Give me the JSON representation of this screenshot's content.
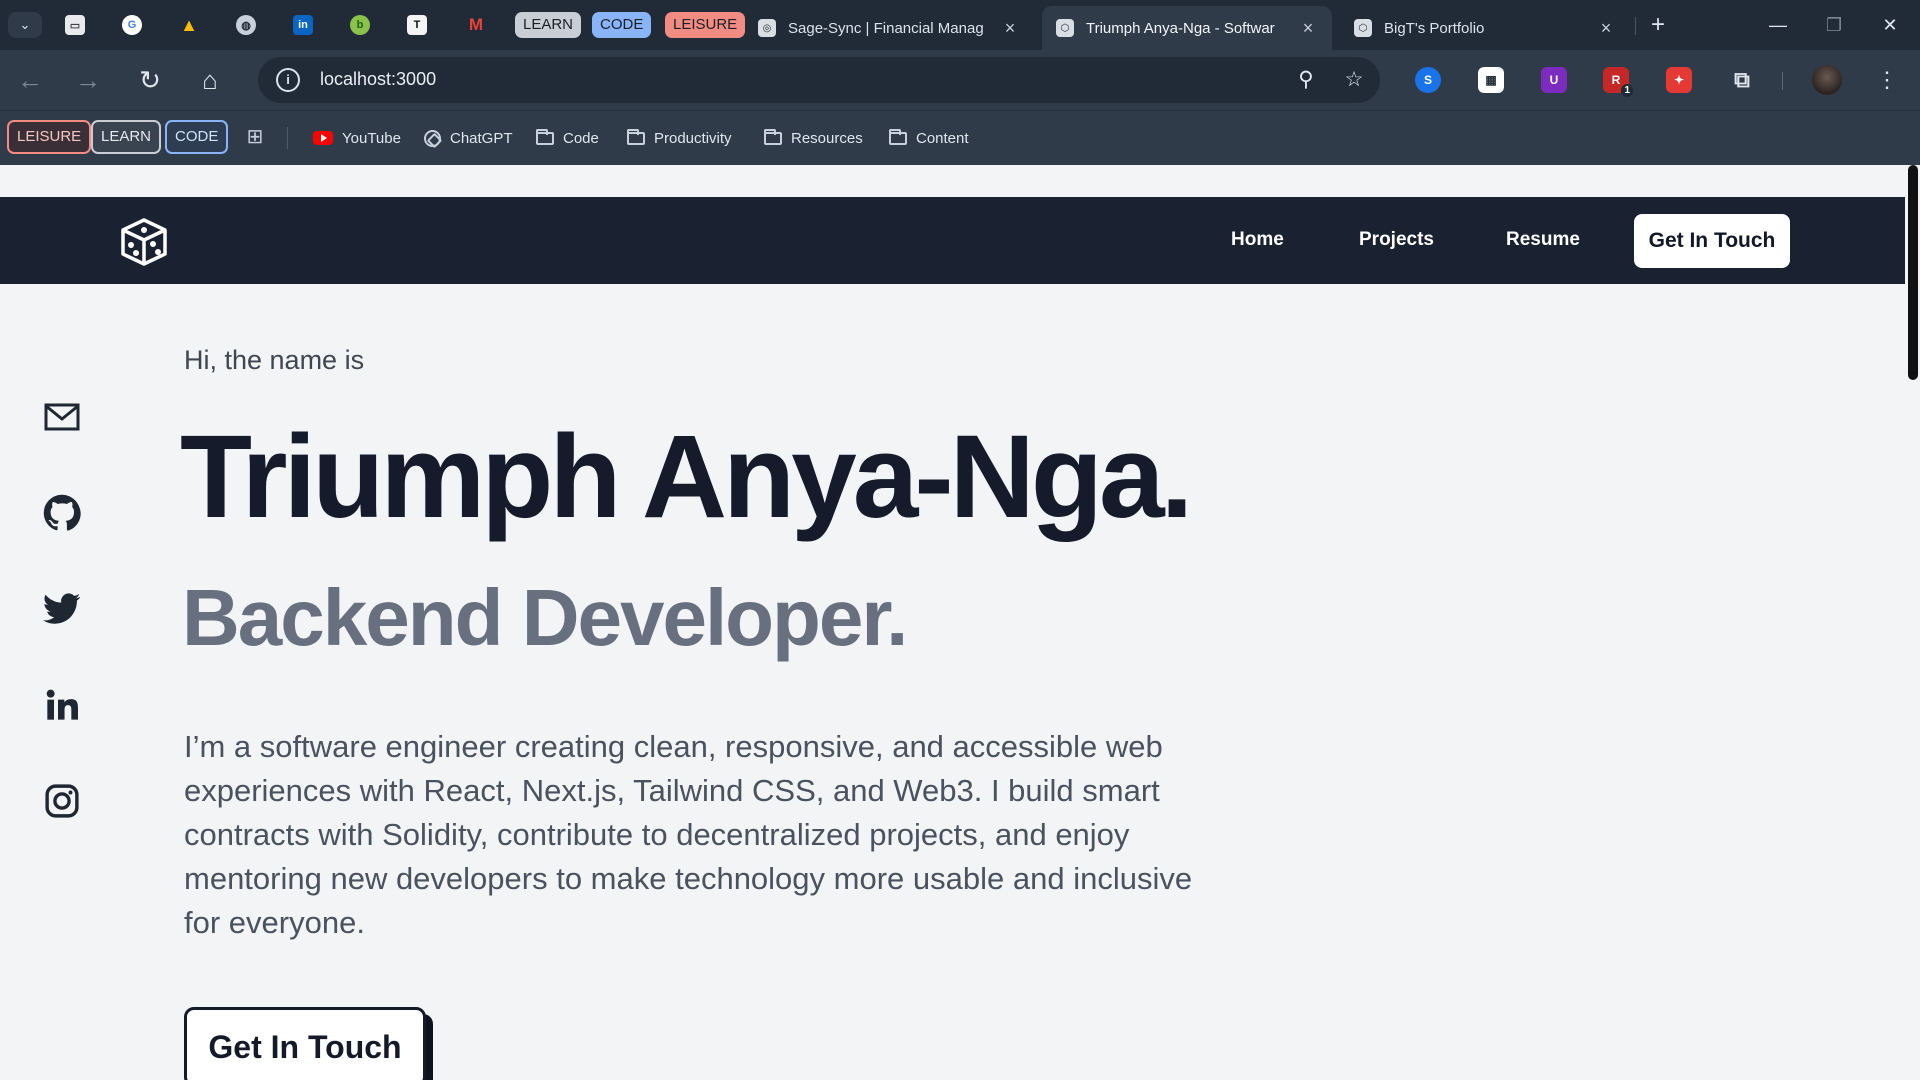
{
  "browser": {
    "tab_groups": [
      {
        "label": "LEARN",
        "color": "#c9ced6"
      },
      {
        "label": "CODE",
        "color": "#8ab4f8"
      },
      {
        "label": "LEISURE",
        "color": "#f28b82"
      }
    ],
    "tabs": [
      {
        "title": "Sage-Sync | Financial Manag",
        "active": false
      },
      {
        "title": "Triumph Anya-Nga - Softwar",
        "active": true
      },
      {
        "title": "BigT's Portfolio",
        "active": false
      }
    ],
    "address": "localhost:3000",
    "bookmarks": {
      "groups": [
        {
          "label": "LEISURE",
          "color": "#f28b82"
        },
        {
          "label": "LEARN",
          "color": "#c9ced6"
        },
        {
          "label": "CODE",
          "color": "#8ab4f8"
        }
      ],
      "items": [
        {
          "label": "YouTube",
          "icon": "youtube-icon"
        },
        {
          "label": "ChatGPT",
          "icon": "chatgpt-icon"
        },
        {
          "label": "Code",
          "icon": "folder-icon"
        },
        {
          "label": "Productivity",
          "icon": "folder-icon"
        },
        {
          "label": "Resources",
          "icon": "folder-icon"
        },
        {
          "label": "Content",
          "icon": "folder-icon"
        }
      ]
    },
    "extension_badge": "1"
  },
  "site": {
    "nav": {
      "links": [
        "Home",
        "Projects",
        "Resume"
      ],
      "cta": "Get In Touch"
    },
    "social_icons": [
      "mail-icon",
      "github-icon",
      "twitter-icon",
      "linkedin-icon",
      "instagram-icon"
    ],
    "hero": {
      "greeting": "Hi, the name is",
      "name": "Triumph Anya-Nga.",
      "role": "Backend Developer.",
      "bio": "I’m a software engineer creating clean, responsive, and accessible web experiences with React, Next.js, Tailwind CSS, and Web3. I build smart contracts with Solidity, contribute to decentralized projects, and enjoy mentoring new developers to make technology more usable and inclusive for everyone.",
      "cta": "Get In Touch"
    }
  }
}
